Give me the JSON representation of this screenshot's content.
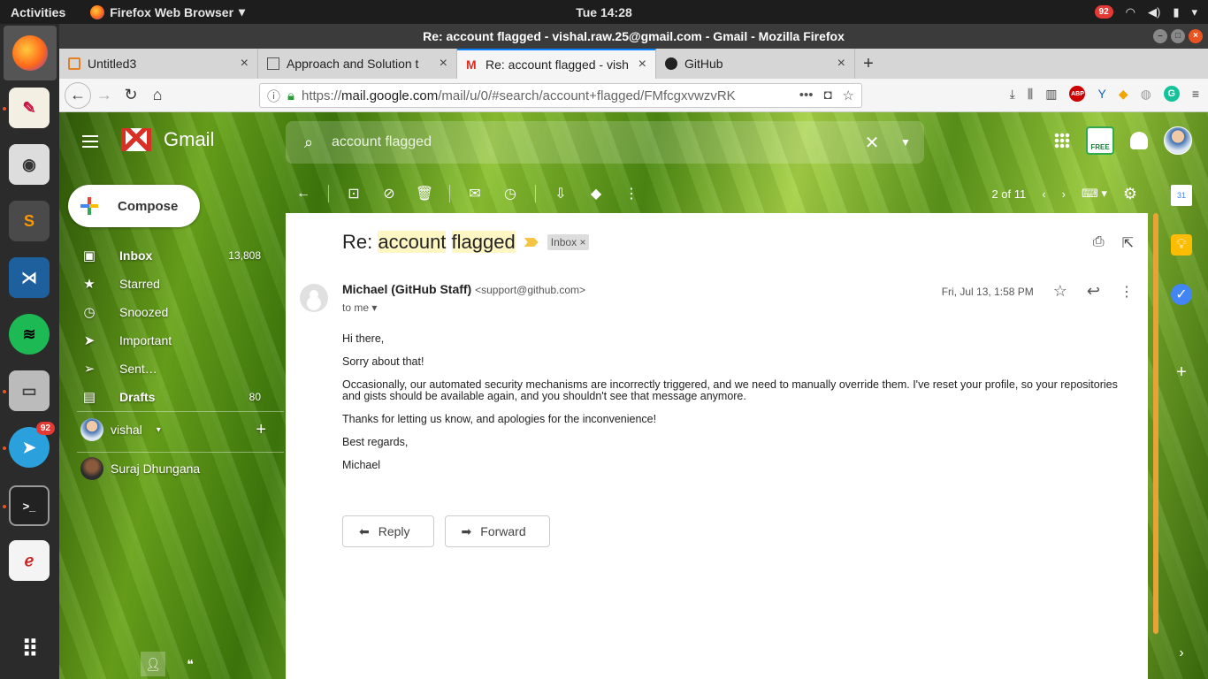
{
  "topbar": {
    "activities": "Activities",
    "app_menu": "Firefox Web Browser",
    "clock": "Tue 14:28",
    "badge": "92"
  },
  "dock": {
    "telegram_badge": "92"
  },
  "firefox": {
    "window_title": "Re: account flagged - vishal.raw.25@gmail.com - Gmail - Mozilla Firefox",
    "tabs": [
      {
        "label": "Untitled3"
      },
      {
        "label": "Approach and Solution t"
      },
      {
        "label": "Re: account flagged - vish"
      },
      {
        "label": "GitHub"
      }
    ],
    "url_prefix": "https://",
    "url_main": "mail.google.com",
    "url_rest": "/mail/u/0/#search/account+flagged/FMfcgxvwzvRK"
  },
  "gmail": {
    "brand": "Gmail",
    "search_value": "account flagged",
    "compose": "Compose",
    "nav": [
      {
        "label": "Inbox",
        "count": "13,808"
      },
      {
        "label": "Starred",
        "count": ""
      },
      {
        "label": "Snoozed",
        "count": ""
      },
      {
        "label": "Important",
        "count": ""
      },
      {
        "label": "Sent…",
        "count": ""
      },
      {
        "label": "Drafts",
        "count": "80"
      }
    ],
    "hangouts_user": "vishal",
    "contact": "Suraj Dhungana",
    "free_badge": "FREE",
    "pagination": "2 of 11"
  },
  "email": {
    "subject_prefix": "Re: ",
    "subject_hl1": "account",
    "subject_hl2": "flagged",
    "label_chip": "Inbox",
    "sender_name": "Michael (GitHub Staff)",
    "sender_email": "<support@github.com>",
    "to": "to me",
    "date": "Fri, Jul 13, 1:58 PM",
    "body": [
      "Hi there,",
      "Sorry about that!",
      "Occasionally, our automated security mechanisms are incorrectly triggered, and we need to manually override them. I've reset your profile, so your repositories and gists should be available again, and you shouldn't see that message anymore.",
      "Thanks for letting us know, and apologies for the inconvenience!",
      "Best regards,",
      "Michael"
    ],
    "reply": "Reply",
    "forward": "Forward"
  },
  "icons": {
    "calendar_day": "31",
    "abp": "ABP",
    "grammarly": "G"
  },
  "colors": {
    "gmail_red": "#d93025",
    "firefox_accent": "#0a84ff",
    "ubuntu_orange": "#e95420",
    "keep_yellow": "#fbbc04",
    "tasks_blue": "#4285f4"
  }
}
